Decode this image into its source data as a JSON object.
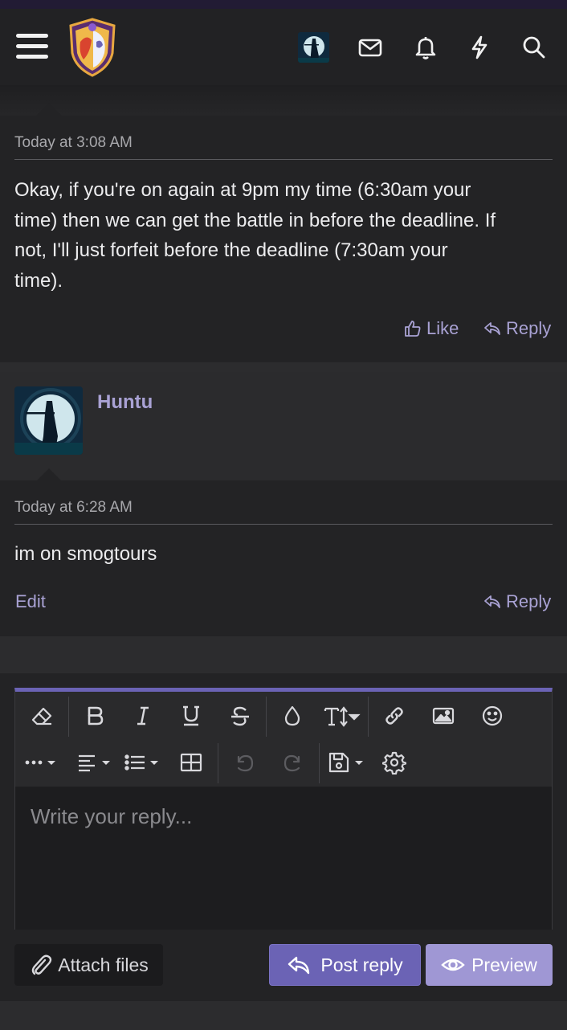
{
  "header": {
    "menu_icon": "hamburger-icon",
    "logo_icon": "forum-shield-logo",
    "icons": [
      "mail-icon",
      "bell-icon",
      "lightning-icon",
      "search-icon"
    ]
  },
  "posts": [
    {
      "timestamp": "Today at 3:08 AM",
      "message_lines": [
        "Okay, if you're on again at 9pm my time (6:30am your",
        "time) then we can get the battle in before the deadline. If",
        "not, I'll just forfeit before the deadline (7:30am your",
        "time)."
      ],
      "like_label": "Like",
      "reply_label": "Reply"
    },
    {
      "username": "Huntu",
      "timestamp": "Today at 6:28 AM",
      "message": "im on smogtours",
      "edit_label": "Edit",
      "reply_label": "Reply"
    }
  ],
  "editor": {
    "placeholder": "Write your reply...",
    "toolbar_icons": [
      "eraser-icon",
      "bold-icon",
      "italic-icon",
      "underline-icon",
      "strikethrough-icon",
      "color-drop-icon",
      "text-size-icon",
      "link-icon",
      "image-icon",
      "smiley-icon",
      "more-icon",
      "align-icon",
      "list-icon",
      "table-icon",
      "undo-icon",
      "redo-icon",
      "save-draft-icon",
      "settings-gear-icon"
    ]
  },
  "buttons": {
    "attach": "Attach files",
    "post_reply": "Post reply",
    "preview": "Preview"
  },
  "colors": {
    "accent": "#6b63b5",
    "link": "#a9a2d4",
    "background": "#1b1b1d"
  }
}
